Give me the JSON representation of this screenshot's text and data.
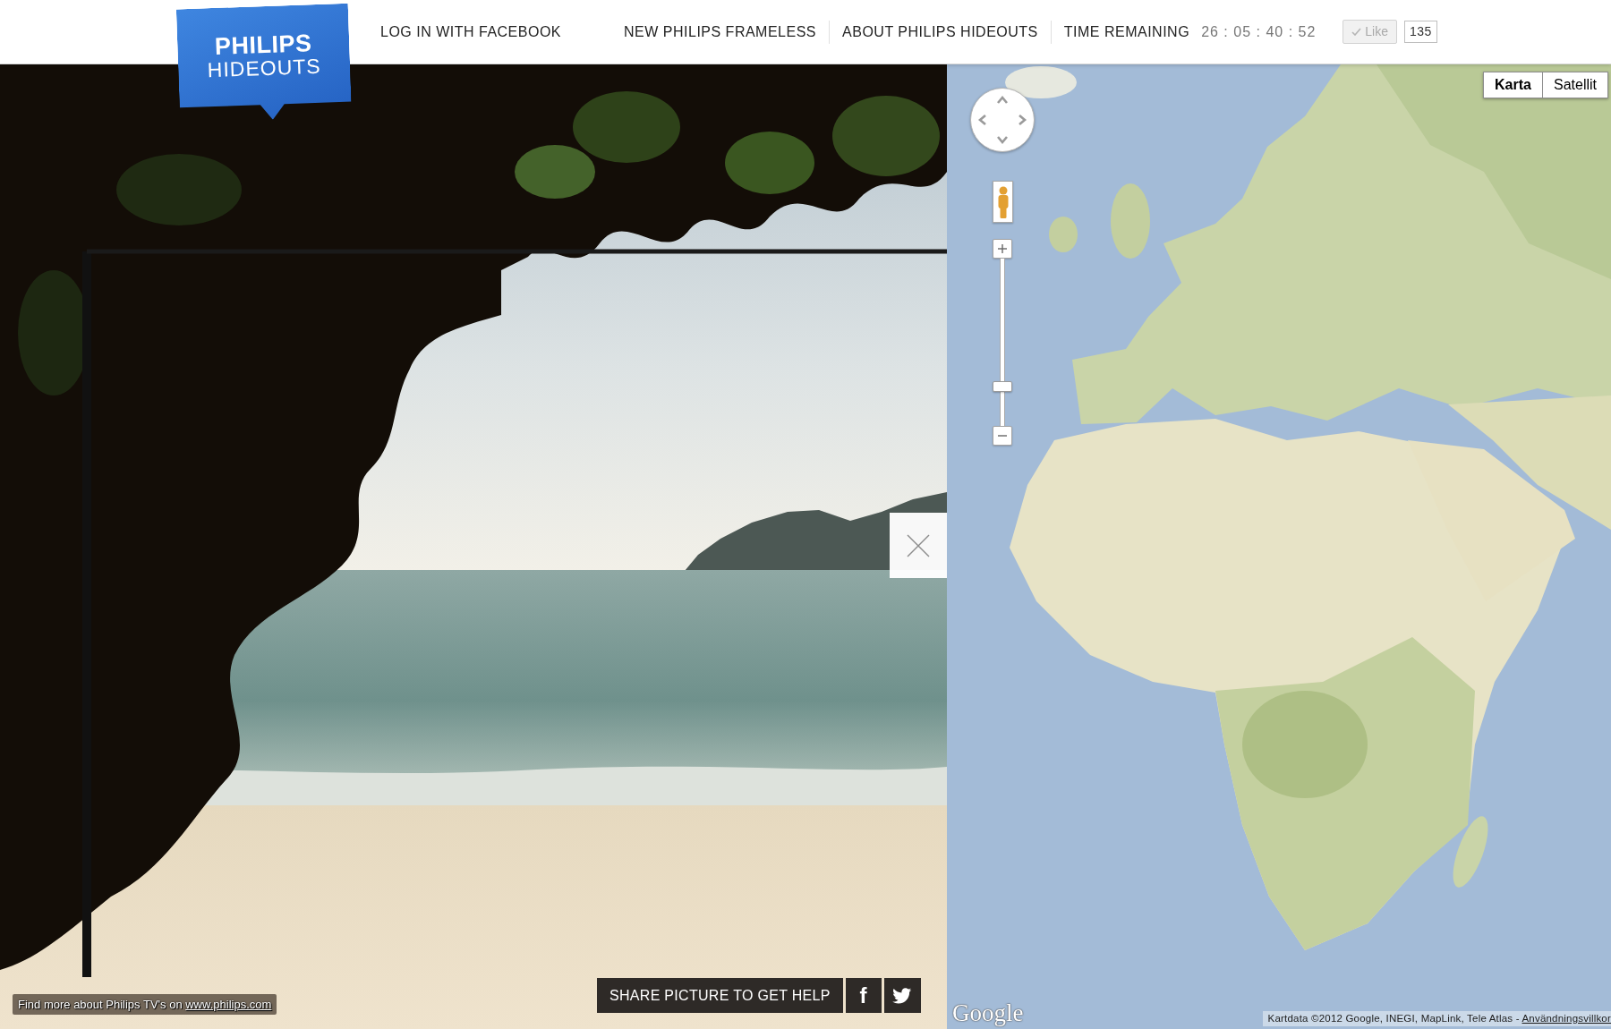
{
  "header": {
    "logo": {
      "title": "PHILIPS",
      "subtitle": "HIDEOUTS"
    },
    "account_link": "LOG IN WITH FACEBOOK",
    "nav": [
      "NEW PHILIPS FRAMELESS",
      "ABOUT PHILIPS HIDEOUTS"
    ],
    "countdown": {
      "label": "TIME REMAINING",
      "value": "26 : 05 : 40 : 52"
    },
    "like_button": {
      "label": "Like",
      "count": "135"
    }
  },
  "photo": {
    "share": {
      "label": "SHARE PICTURE TO GET HELP",
      "facebook": "f"
    },
    "credit": {
      "text": "Find more about Philips TV's on",
      "link": "www.philips.com"
    }
  },
  "map": {
    "map_types": [
      {
        "label": "Karta",
        "selected": true
      },
      {
        "label": "Satellit",
        "selected": false
      }
    ],
    "zoom": {
      "level": 0.22
    },
    "logo": "Google",
    "attribution": "Kartdata ©2012 Google, INEGI, MapLink, Tele Atlas -",
    "terms_link": "Användningsvillkor"
  }
}
